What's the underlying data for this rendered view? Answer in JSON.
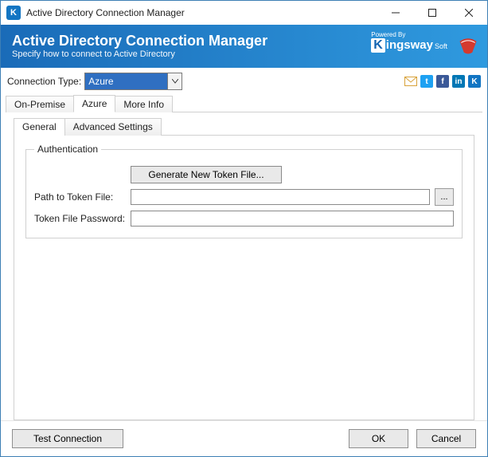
{
  "window": {
    "title": "Active Directory Connection Manager",
    "app_icon_letter": "K"
  },
  "banner": {
    "title": "Active Directory Connection Manager",
    "subtitle": "Specify how to connect to Active Directory",
    "powered_by": "Powered By",
    "brand_k": "K",
    "brand_rest": "ingsway",
    "brand_soft": "Soft"
  },
  "conn": {
    "label": "Connection Type:",
    "value": "Azure"
  },
  "social": {
    "tw": "t",
    "fb": "f",
    "li": "in",
    "ks": "K"
  },
  "outer_tabs": {
    "onprem": "On-Premise",
    "azure": "Azure",
    "more": "More Info"
  },
  "inner_tabs": {
    "general": "General",
    "advanced": "Advanced Settings"
  },
  "auth": {
    "legend": "Authentication",
    "generate": "Generate New Token File...",
    "path_label": "Path to Token File:",
    "path_value": "",
    "pw_label": "Token File Password:",
    "pw_value": "",
    "browse": "..."
  },
  "footer": {
    "test": "Test Connection",
    "ok": "OK",
    "cancel": "Cancel"
  }
}
